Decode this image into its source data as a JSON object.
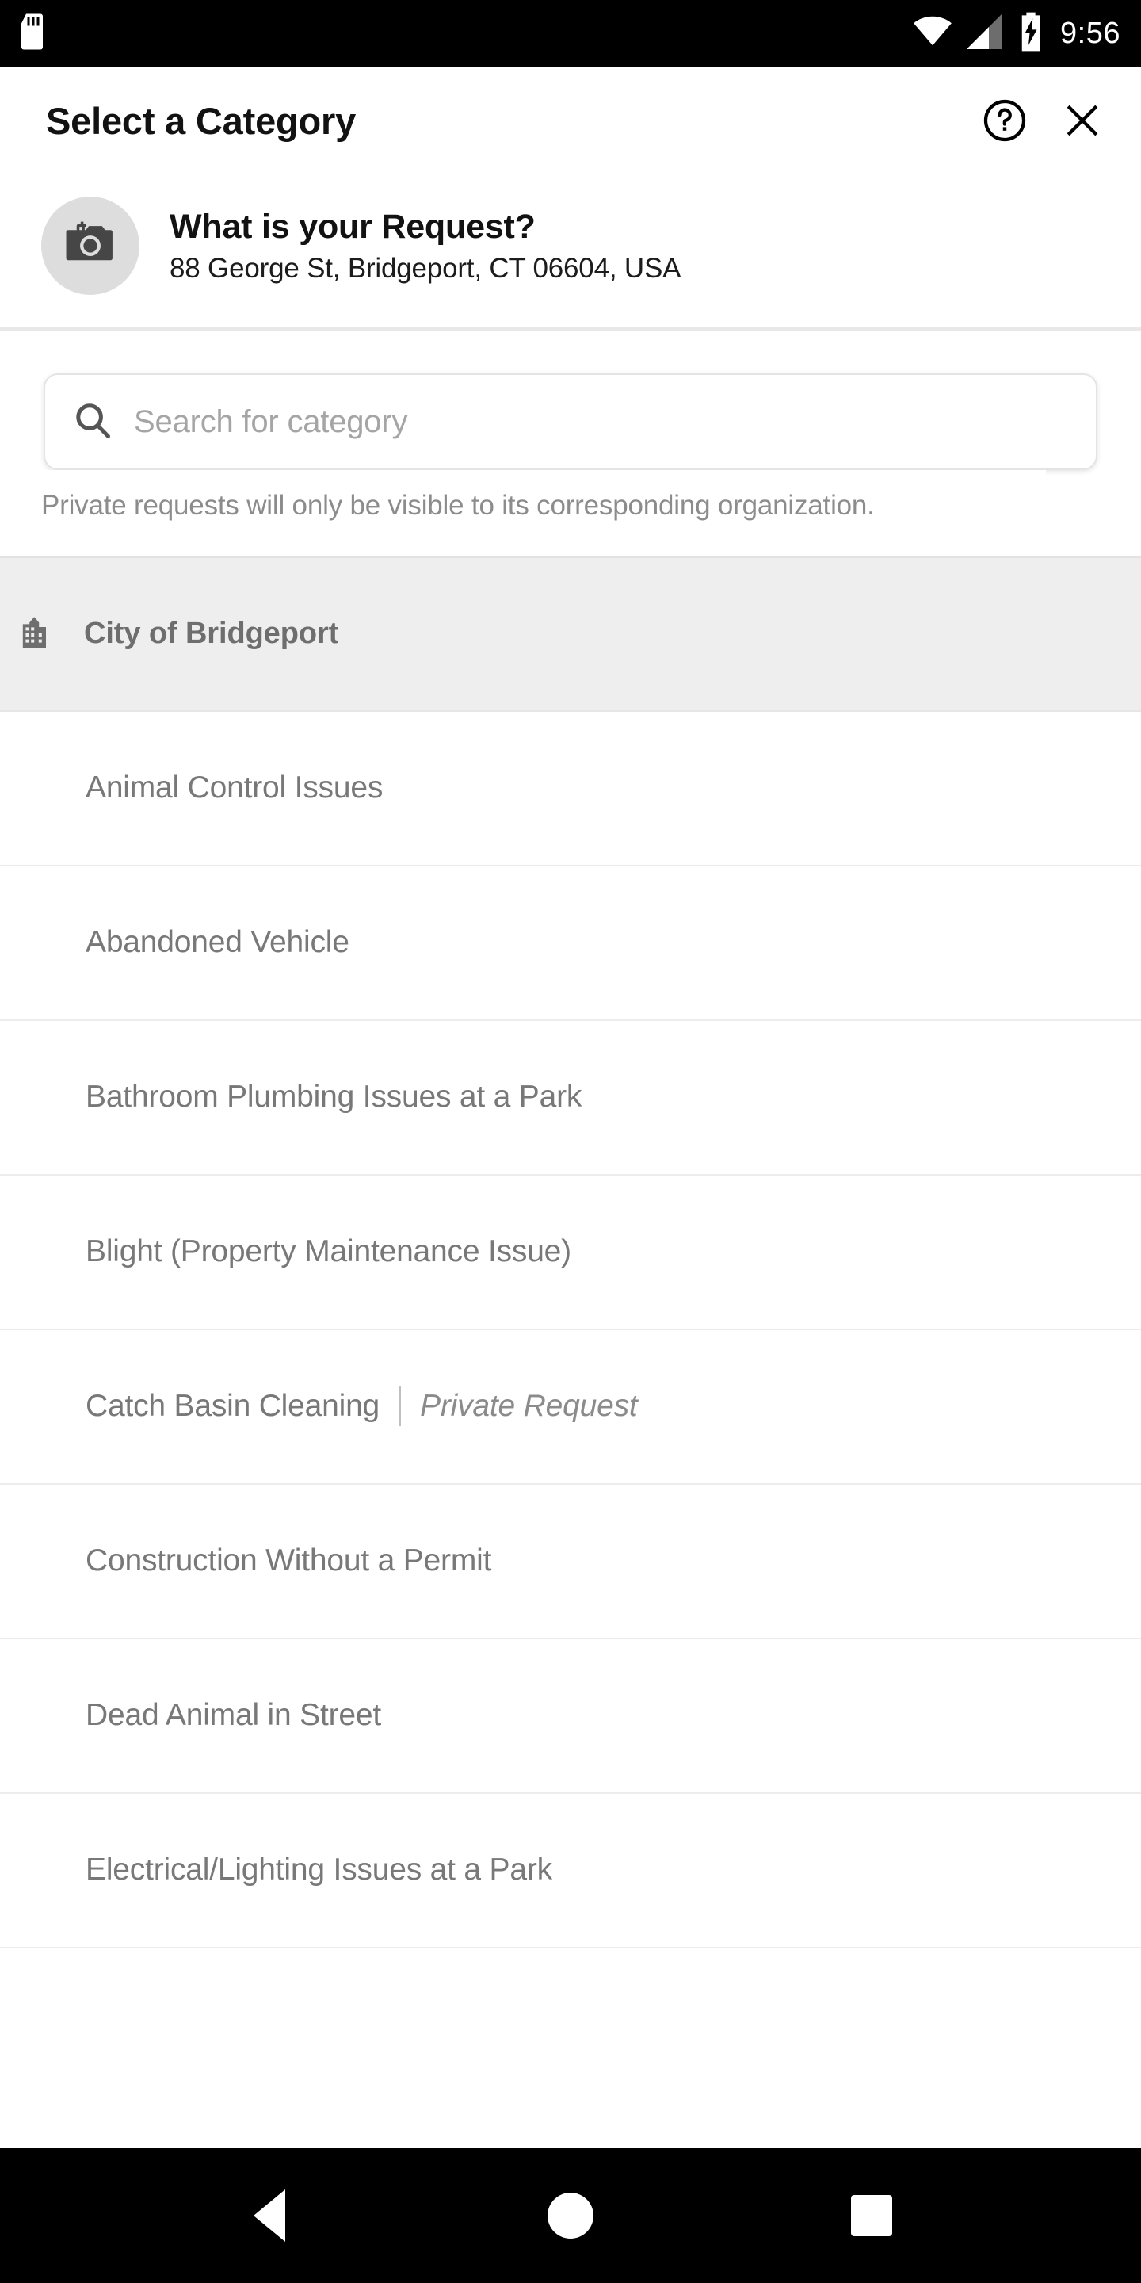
{
  "status_bar": {
    "time": "9:56",
    "icons": [
      "sd-card-icon",
      "wifi-icon",
      "cellular-signal-icon",
      "battery-charging-icon"
    ]
  },
  "title_bar": {
    "title": "Select a Category",
    "help_icon": "help-circle-icon",
    "close_icon": "close-icon"
  },
  "request": {
    "avatar_icon": "add-a-photo-icon",
    "title": "What is your Request?",
    "address": "88 George St, Bridgeport, CT 06604, USA"
  },
  "search": {
    "icon": "search-icon",
    "placeholder": "Search for category",
    "value": ""
  },
  "note": "Private requests will only be visible to its corresponding organization.",
  "section": {
    "icon": "city-building-icon",
    "title": "City of Bridgeport"
  },
  "categories": [
    {
      "label": "Animal Control Issues",
      "badge": ""
    },
    {
      "label": "Abandoned Vehicle",
      "badge": ""
    },
    {
      "label": "Bathroom Plumbing Issues at a Park",
      "badge": ""
    },
    {
      "label": "Blight (Property Maintenance Issue)",
      "badge": ""
    },
    {
      "label": "Catch Basin Cleaning",
      "badge": "Private Request"
    },
    {
      "label": "Construction Without a Permit",
      "badge": ""
    },
    {
      "label": "Dead Animal in Street",
      "badge": ""
    },
    {
      "label": "Electrical/Lighting Issues at a Park",
      "badge": ""
    }
  ],
  "nav_bar": {
    "back": "back-nav-icon",
    "home": "home-nav-icon",
    "recents": "recents-nav-icon"
  },
  "colors": {
    "background": "#ffffff",
    "section_bg": "#eeeeee",
    "text_primary": "#121212",
    "text_muted": "#787878",
    "divider": "#ececec",
    "status_bg": "#000000"
  }
}
